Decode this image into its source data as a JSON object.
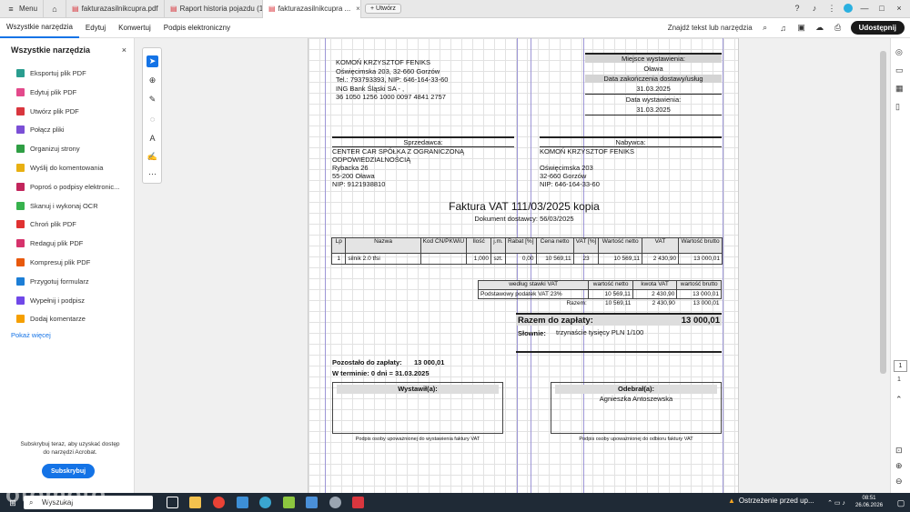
{
  "browser": {
    "menu_label": "Menu",
    "tabs": [
      {
        "title": "fakturazasilnikcupra.pdf"
      },
      {
        "title": "Raport historia pojazdu (1)..."
      },
      {
        "title": "fakturazasilnikcupra ..."
      }
    ],
    "new_tab": "+ Utwórz"
  },
  "toolbar": {
    "items": [
      "Wszystkie narzędzia",
      "Edytuj",
      "Konwertuj",
      "Podpis elektroniczny"
    ],
    "find": "Znajdź tekst lub narzędzia",
    "share": "Udostępnij"
  },
  "sidebar": {
    "title": "Wszystkie narzędzia",
    "close": "×",
    "tools": [
      {
        "label": "Eksportuj plik PDF",
        "color": "#2a9d8f"
      },
      {
        "label": "Edytuj plik PDF",
        "color": "#e34a8b"
      },
      {
        "label": "Utwórz plik PDF",
        "color": "#d9363e"
      },
      {
        "label": "Połącz pliki",
        "color": "#7b4fd6"
      },
      {
        "label": "Organizuj strony",
        "color": "#2f9e44"
      },
      {
        "label": "Wyślij do komentowania",
        "color": "#e8b012"
      },
      {
        "label": "Poproś o podpisy elektronic...",
        "color": "#c2255c"
      },
      {
        "label": "Skanuj i wykonaj OCR",
        "color": "#37b24d"
      },
      {
        "label": "Chroń plik PDF",
        "color": "#e03131"
      },
      {
        "label": "Redaguj plik PDF",
        "color": "#d6336c"
      },
      {
        "label": "Kompresuj plik PDF",
        "color": "#e8590c"
      },
      {
        "label": "Przygotuj formularz",
        "color": "#1c7ed6"
      },
      {
        "label": "Wypełnij i podpisz",
        "color": "#7048e8"
      },
      {
        "label": "Dodaj komentarze",
        "color": "#f59f00"
      }
    ],
    "more": "Pokaż więcej",
    "subscribe_text": "Subskrybuj teraz, aby uzyskać dostęp do narzędzi Acrobat.",
    "subscribe_btn": "Subskrybuj"
  },
  "right_panel": {
    "page_current": "1",
    "page_total": "1"
  },
  "invoice": {
    "seller_block": [
      "KOMOŃ KRZYSZTOF FENIKS",
      "Oświęcimska 203, 32-660 Gorzów",
      "Tel.: 793793393, NIP: 646-164-33-60",
      "ING Bank Śląski SA - ,",
      "36 1050 1256 1000 0097 4841 2757"
    ],
    "place_label": "Miejsce wystawienia:",
    "place": "Oława",
    "delivery_label": "Data zakończenia dostawy/usług",
    "delivery": "31.03.2025",
    "issue_label": "Data wystawienia:",
    "issue": "31.03.2025",
    "seller_label": "Sprzedawca:",
    "seller": [
      "CENTER CAR SPÓŁKA Z OGRANICZONĄ",
      "ODPOWIEDZIALNOŚCIĄ",
      "Rybacka 26",
      "55-200 Oława",
      "NIP: 9121938810"
    ],
    "buyer_label": "Nabywca:",
    "buyer": [
      "KOMOŃ KRZYSZTOF FENIKS",
      "",
      "Oświęcimska 203",
      "32-660 Gorzów",
      "NIP: 646-164-33-60"
    ],
    "title": "Faktura VAT  111/03/2025 kopia",
    "subtitle": "Dokument dostawcy: 56/03/2025",
    "items_headers": [
      "Lp",
      "Nazwa",
      "Kod CN/PKWiU",
      "Ilość",
      "j.m.",
      "Rabat [%]",
      "Cena netto",
      "VAT [%]",
      "Wartość netto",
      "VAT",
      "Wartość brutto"
    ],
    "items": [
      [
        "1",
        "silnik 2.0 tfsi",
        "",
        "1,000",
        "szt.",
        "0,00",
        "10 569,11",
        "23",
        "10 569,11",
        "2 430,90",
        "13 000,01"
      ]
    ],
    "vat_headers": [
      "według stawki VAT",
      "wartość netto",
      "kwota VAT",
      "wartość brutto"
    ],
    "vat_rows": [
      [
        "Podstawowy podatek VAT 23%",
        "10 569,11",
        "2 430,90",
        "13 000,01"
      ]
    ],
    "vat_total_label": "Razem:",
    "vat_total": [
      "10 569,11",
      "2 430,90",
      "13 000,01"
    ],
    "total_label": "Razem do zapłaty:",
    "total": "13 000,01",
    "words_label": "Słownie:",
    "words": "trzynaście tysięcy  PLN  1/100",
    "remaining_label": "Pozostało do zapłaty:",
    "remaining": "13 000,01",
    "term": "W terminie: 0 dni = 31.03.2025",
    "issued_label": "Wystawił(a):",
    "issued_note": "Podpis osoby upoważnionej do wystawienia faktury VAT",
    "received_label": "Odebrał(a):",
    "received_name": "Agnieszka Antoszewska",
    "received_note": "Podpis osoby upoważnionej do odbioru faktury VAT"
  },
  "taskbar": {
    "search": "Wyszukaj",
    "warning": "Ostrzeżenie przed up...",
    "time": "08:51",
    "date": "26.06.2026"
  },
  "watermark": "otomoto"
}
